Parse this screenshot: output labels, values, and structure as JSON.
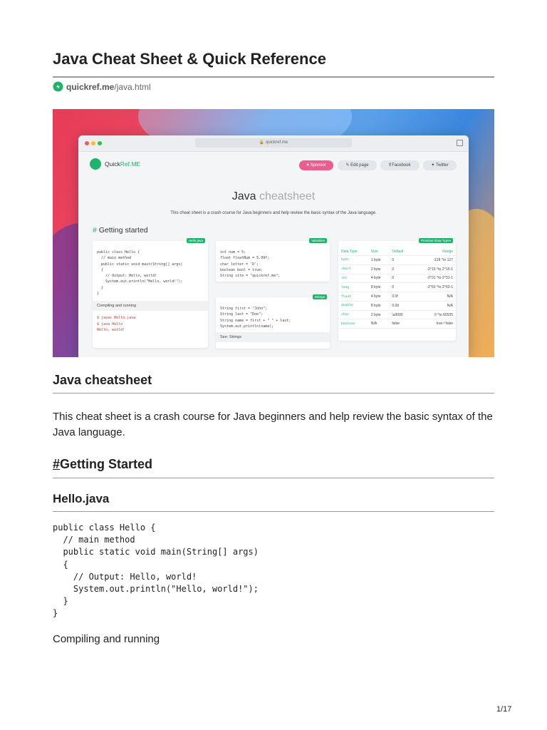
{
  "doc": {
    "title": "Java Cheat Sheet & Quick Reference",
    "source_domain": "quickref.me",
    "source_path": "/java.html",
    "page_number": "1/17"
  },
  "hero": {
    "url": "quickref.me",
    "brand_prefix": "Quick",
    "brand_suffix": "Ref.ME",
    "buttons": {
      "sponsor": "Sponsor",
      "edit": "Edit page",
      "facebook": "Facebook",
      "twitter": "Twitter"
    },
    "title_main": "Java",
    "title_light": " cheatsheet",
    "desc": "This cheat sheet is a crash course for Java beginners and help review the basic syntax of the Java language.",
    "section_hash": "#",
    "section_text": " Getting started",
    "card1": {
      "tag": "Hello.java",
      "code": "public class Hello {\n  // main method\n  public static void main(String[] args)\n  {\n    // Output: Hello, world!\n    System.out.println(\"Hello, world!\");\n  }\n}",
      "sub": "Compiling and running",
      "code2": "$ javac Hello.java\n$ java Hello\nHello, world!"
    },
    "card2": {
      "tag": "Variables",
      "code": "int num = 5;\nfloat floatNum = 5.99f;\nchar letter = 'D';\nboolean bool = true;\nString site = \"quickref.me\";"
    },
    "card3": {
      "tag": "Strings",
      "code": "String first = \"John\";\nString last = \"Doe\";\nString name = first + \" \" + last;\nSystem.out.println(name);",
      "sub": "See: Strings"
    },
    "card4": {
      "tag": "Primitive Data Types",
      "headers": [
        "Data Type",
        "Size",
        "Default",
        "Range"
      ],
      "rows": [
        [
          "byte",
          "1 byte",
          "0",
          "-128 ^to 127"
        ],
        [
          "short",
          "2 byte",
          "0",
          "-2^15 ^to 2^15-1"
        ],
        [
          "int",
          "4 byte",
          "0",
          "-2^31 ^to 2^31-1"
        ],
        [
          "long",
          "8 byte",
          "0",
          "-2^63 ^to 2^63-1"
        ],
        [
          "float",
          "4 byte",
          "0.0f",
          "N/A"
        ],
        [
          "double",
          "8 byte",
          "0.0d",
          "N/A"
        ],
        [
          "char",
          "2 byte",
          "\\u0000",
          "0 ^to 65535"
        ],
        [
          "boolean",
          "N/A",
          "false",
          "true / false"
        ]
      ]
    }
  },
  "sections": {
    "cheatsheet_heading": "Java cheatsheet",
    "cheatsheet_paragraph": "This cheat sheet is a crash course for Java beginners and help review the basic syntax of the Java language.",
    "getting_started_hash": "#",
    "getting_started_text": "Getting Started",
    "hello_heading": "Hello.java",
    "hello_code": "public class Hello {\n  // main method\n  public static void main(String[] args)\n  {\n    // Output: Hello, world!\n    System.out.println(\"Hello, world!\");\n  }\n}",
    "compiling_text": "Compiling and running"
  },
  "icons": [
    "quickref-logo-icon",
    "lock-icon",
    "copy-icon",
    "heart-icon",
    "pencil-icon",
    "facebook-icon",
    "twitter-icon"
  ],
  "colors": {
    "brand_green": "#1fb46a",
    "sponsor_pink": "#ec5d8f"
  }
}
